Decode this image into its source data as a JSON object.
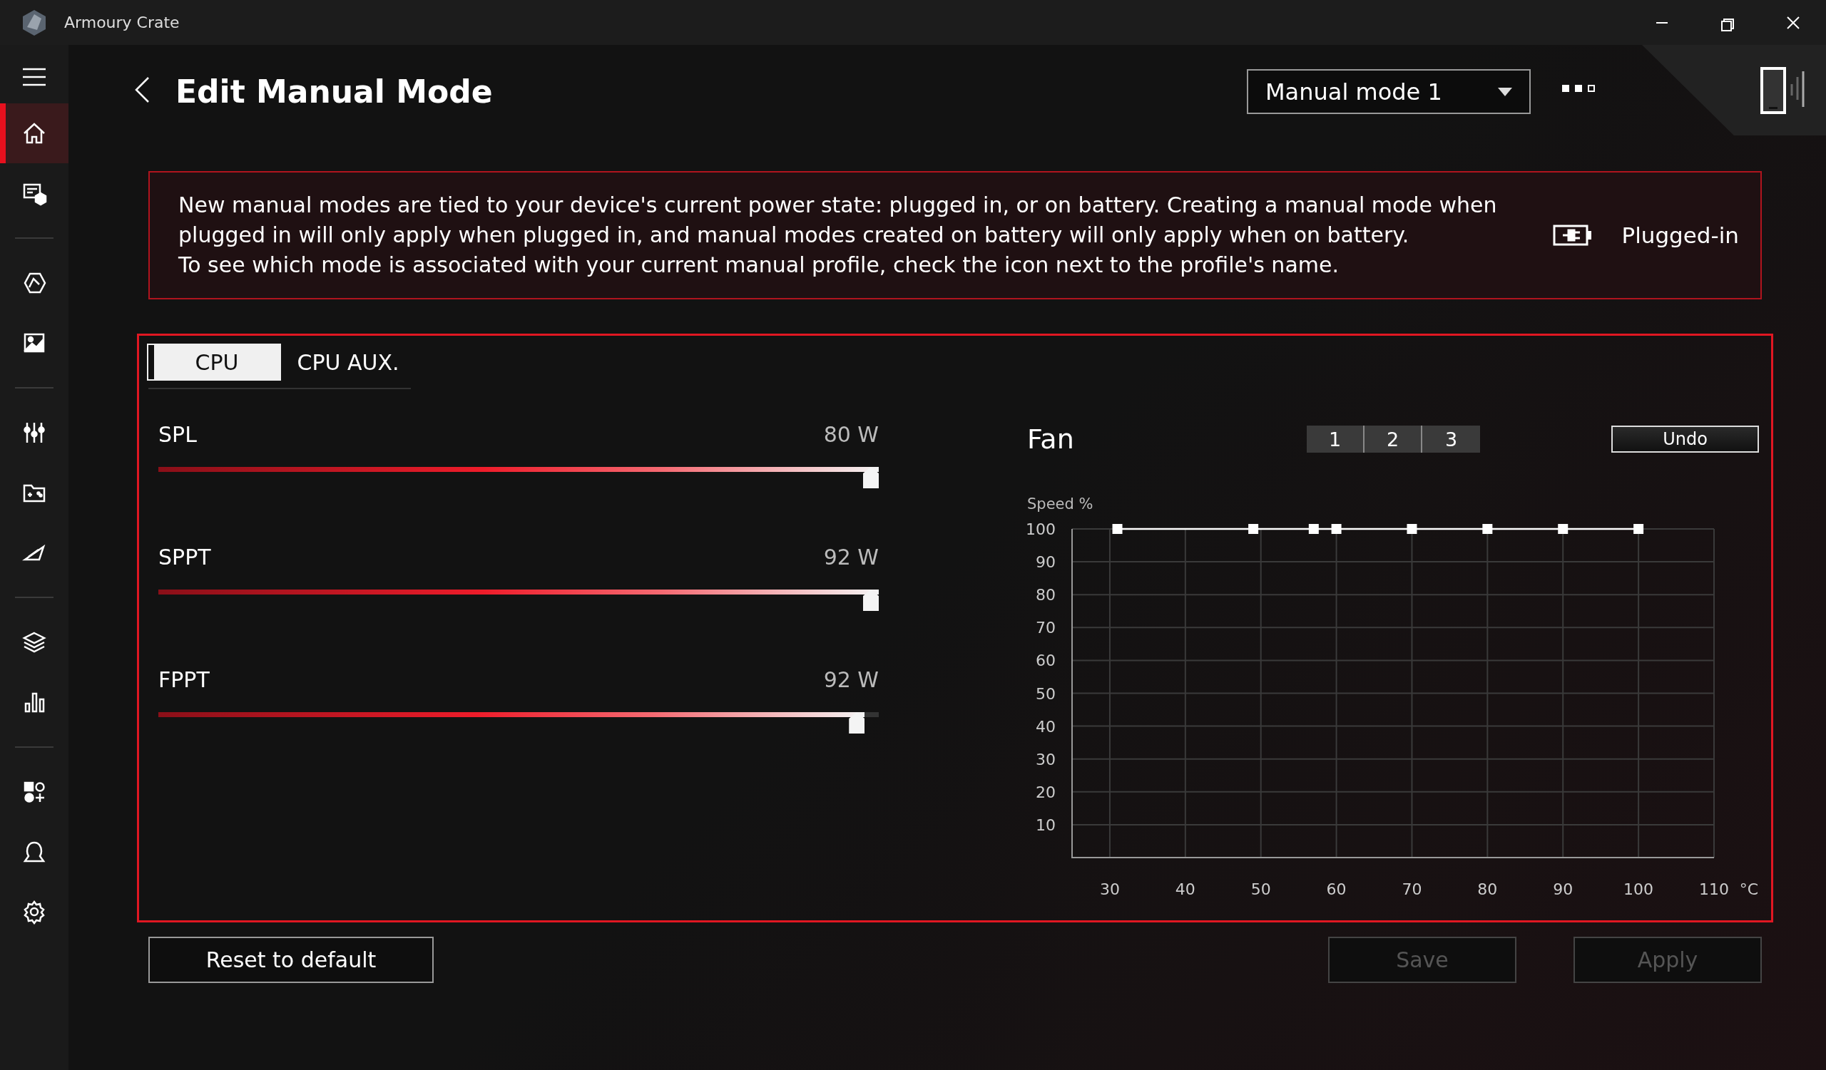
{
  "window": {
    "title": "Armoury Crate"
  },
  "sidebar": {
    "groups": [
      [
        {
          "selected": true
        },
        {
          "selected": false
        }
      ],
      [
        {
          "selected": false
        },
        {
          "selected": false
        }
      ],
      [
        {
          "selected": false
        },
        {
          "selected": false
        },
        {
          "selected": false
        }
      ],
      [
        {
          "selected": false
        },
        {
          "selected": false
        }
      ],
      [
        {
          "selected": false
        },
        {
          "selected": false
        },
        {
          "selected": false
        }
      ]
    ]
  },
  "header": {
    "title": "Edit Manual Mode",
    "mode_select": {
      "value": "Manual mode 1"
    }
  },
  "notice": {
    "lines": [
      "New manual modes are tied to your device's current power state: plugged in, or on battery. Creating a manual mode when plugged in will only apply when plugged in, and manual modes created on battery will only apply when on battery.",
      "To see which mode is associated with your current manual profile, check the icon next to the profile's name."
    ],
    "power_state": "Plugged-in"
  },
  "tabs": [
    {
      "label": "CPU",
      "selected": true
    },
    {
      "label": "CPU AUX.",
      "selected": false
    }
  ],
  "sliders": [
    {
      "name": "SPL",
      "reading": "80 W",
      "level": 1.0
    },
    {
      "name": "SPPT",
      "reading": "92 W",
      "level": 1.0
    },
    {
      "name": "FPPT",
      "reading": "92 W",
      "level": 0.98
    }
  ],
  "fan": {
    "title": "Fan",
    "profiles": [
      {
        "label": "1",
        "selected": false
      },
      {
        "label": "2",
        "selected": false
      },
      {
        "label": "3",
        "selected": false
      }
    ],
    "undo": "Undo",
    "chart_data": {
      "type": "line",
      "ylabel": "Speed %",
      "xlabel": "°C",
      "x": [
        31,
        49,
        57,
        60,
        70,
        80,
        90,
        100
      ],
      "grid": true,
      "series": [
        {
          "color": "#ffffff",
          "marker": "square",
          "values": [
            100,
            100,
            100,
            100,
            100,
            100,
            100,
            100
          ]
        }
      ],
      "xlim": [
        25,
        110
      ],
      "ylim": [
        0,
        100
      ],
      "xticks": [
        30,
        40,
        50,
        60,
        70,
        80,
        90,
        100,
        110
      ],
      "yticks": [
        10,
        20,
        30,
        40,
        50,
        60,
        70,
        80,
        90,
        100
      ]
    }
  },
  "buttons": [
    {
      "kind": "reset",
      "label": "Reset to default",
      "disabled": false
    },
    {
      "kind": "save",
      "label": "Save",
      "disabled": true
    },
    {
      "kind": "apply",
      "label": "Apply",
      "disabled": true
    }
  ]
}
